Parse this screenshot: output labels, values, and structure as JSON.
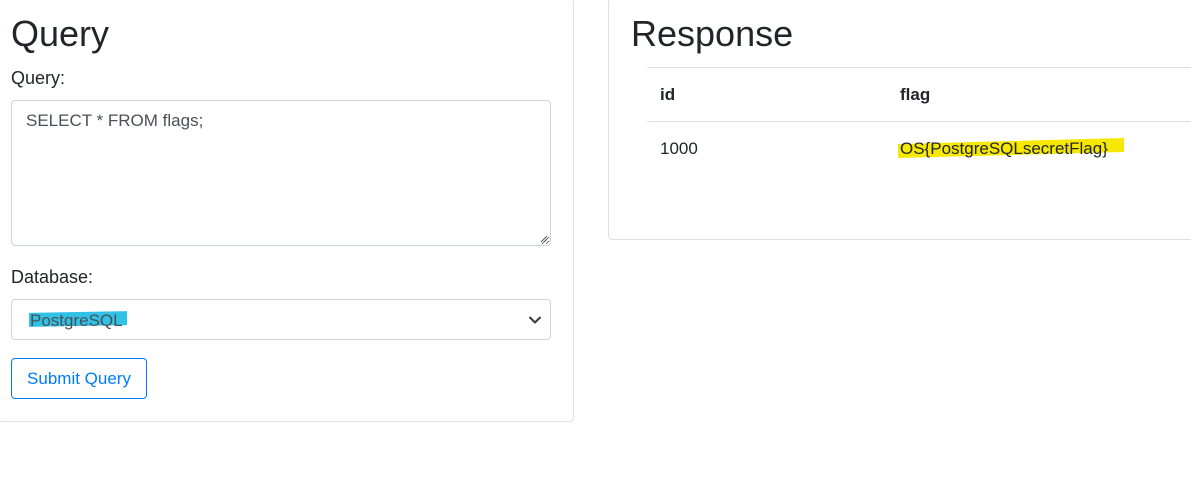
{
  "query_panel": {
    "title": "Query",
    "query_label": "Query:",
    "query_value": "SELECT * FROM flags;",
    "database_label": "Database:",
    "database_selected": "PostgreSQL",
    "submit_label": "Submit Query"
  },
  "response_panel": {
    "title": "Response",
    "columns": [
      "id",
      "flag"
    ],
    "rows": [
      [
        "1000",
        "OS{PostgreSQLsecretFlag}"
      ]
    ]
  },
  "colors": {
    "primary": "#007bff",
    "db_highlight": "#2fc1e6",
    "flag_highlight": "#f6e800"
  },
  "icons": {
    "select_arrow": "chevron-down-icon",
    "textarea_resize": "resize-grip-icon"
  }
}
